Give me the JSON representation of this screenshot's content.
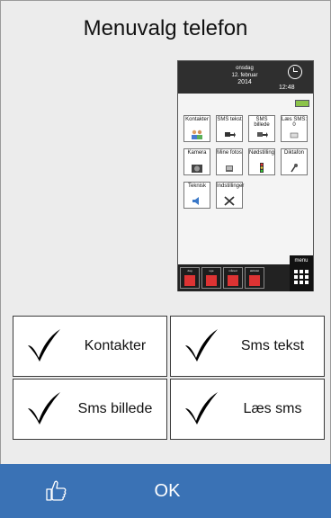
{
  "title": "Menuvalg telefon",
  "phone_preview": {
    "day": "onsdag",
    "date": "12. februar",
    "year": "2014",
    "time": "12:48",
    "tiles": [
      {
        "label": "Kontakter",
        "icon": "contacts-icon"
      },
      {
        "label": "SMS tekst",
        "icon": "sms-text-icon"
      },
      {
        "label": "SMS billede",
        "icon": "sms-image-icon"
      },
      {
        "label": "Læs SMS: 0",
        "icon": "read-sms-icon"
      },
      {
        "label": "Kamera",
        "icon": "camera-icon"
      },
      {
        "label": "Mine fotos",
        "icon": "photos-icon"
      },
      {
        "label": "Nødstilling",
        "icon": "traffic-light-icon"
      },
      {
        "label": "Diktafon",
        "icon": "microphone-icon"
      },
      {
        "label": "Teknisk",
        "icon": "speaker-icon"
      },
      {
        "label": "Indstillinger",
        "icon": "tools-icon"
      }
    ],
    "bottom_menu": [
      "dag",
      "uge",
      "måned",
      "aktivitet"
    ],
    "menu_label": "menu"
  },
  "options": [
    {
      "label": "Kontakter",
      "checked": true
    },
    {
      "label": "Sms tekst",
      "checked": true
    },
    {
      "label": "Sms billede",
      "checked": true
    },
    {
      "label": "Læs sms",
      "checked": true
    }
  ],
  "ok_button": {
    "label": "OK",
    "icon": "thumbs-up-icon"
  },
  "colors": {
    "accent": "#3a72b5",
    "background": "#ececec"
  }
}
